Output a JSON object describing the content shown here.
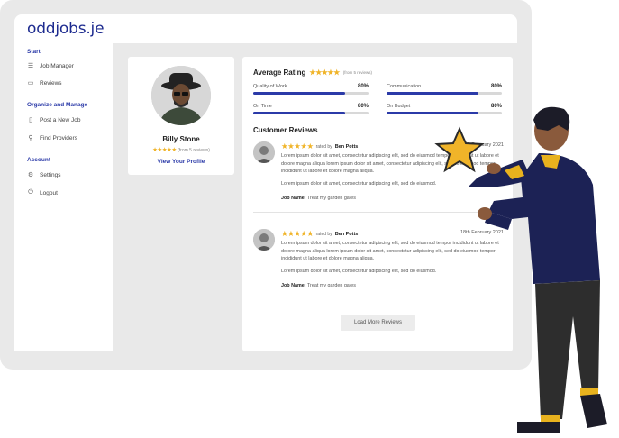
{
  "app": {
    "logo": "oddjobs.je"
  },
  "sidebar": {
    "sections": [
      {
        "title": "Start",
        "items": [
          {
            "label": "Job Manager",
            "icon": "list-icon"
          },
          {
            "label": "Reviews",
            "icon": "chat-icon"
          }
        ]
      },
      {
        "title": "Organize and Manage",
        "items": [
          {
            "label": "Post a New Job",
            "icon": "document-icon"
          },
          {
            "label": "Find Providers",
            "icon": "search-icon"
          }
        ]
      },
      {
        "title": "Account",
        "items": [
          {
            "label": "Settings",
            "icon": "gear-icon"
          },
          {
            "label": "Logout",
            "icon": "power-icon"
          }
        ]
      }
    ]
  },
  "profile": {
    "name": "Billy Stone",
    "rating": 5,
    "reviews_count": "(from 5 reviews)",
    "link": "View Your Profile"
  },
  "ratings": {
    "title": "Average Rating",
    "count": "(from 5 reviews)",
    "metrics": [
      {
        "label": "Quality of Work",
        "value": "80%",
        "fraction": 0.8
      },
      {
        "label": "Communication",
        "value": "80%",
        "fraction": 0.8
      },
      {
        "label": "On Time",
        "value": "80%",
        "fraction": 0.8
      },
      {
        "label": "On Budget",
        "value": "80%",
        "fraction": 0.8
      }
    ]
  },
  "reviews": {
    "title": "Customer Reviews",
    "items": [
      {
        "rated_by": "rated by",
        "author": "Ben Potts",
        "date": "18th February 2021",
        "para1": "Lorem ipsum dolor sit amet, consectetur adipiscing elit, sed do eiusmod tempor incididunt ut labore et dolore magna aliqua lorem ipsum dolor sit amet, consectetur adipiscing elit, sed do eiusmod tempor incididunt ut labore et dolore magna aliqua.",
        "para2": "Lorem ipsum dolor sit amet, consectetur adipiscing elit, sed do eiusmod.",
        "job_label": "Job Name:",
        "job_name": "Treat my garden gates"
      },
      {
        "rated_by": "rated by",
        "author": "Ben Potts",
        "date": "18th February 2021",
        "para1": "Lorem ipsum dolor sit amet, consectetur adipiscing elit, sed do eiusmod tempor incididunt ut labore et dolore magna aliqua lorem ipsum dolor sit amet, consectetur adipiscing elit, sed do eiusmod tempor incididunt ut labore et dolore magna aliqua.",
        "para2": "Lorem ipsum dolor sit amet, consectetur adipiscing elit, sed do eiusmod.",
        "job_label": "Job Name:",
        "job_name": "Treat my garden gates"
      }
    ],
    "load_more": "Load More Reviews"
  },
  "colors": {
    "accent": "#2b3aa8",
    "star": "#f0b429",
    "navy_jacket": "#1c2255",
    "mustard": "#e8b21e"
  }
}
